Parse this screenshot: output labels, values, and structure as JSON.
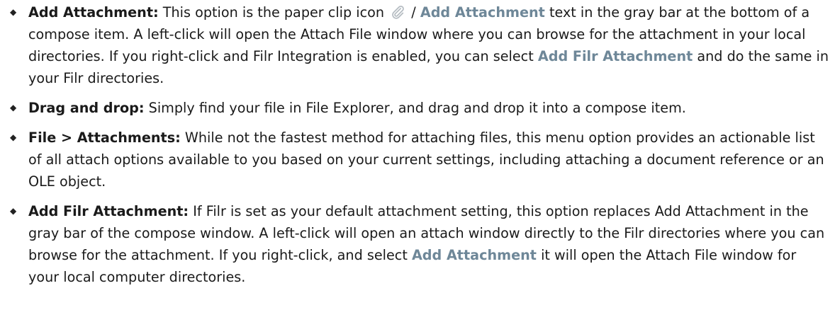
{
  "items": [
    {
      "lead": "Add Attachment:",
      "t1": " This option is the paper clip icon ",
      "sep": " / ",
      "term1": "Add Attachment",
      "t2": " text in the gray bar at the bottom of a compose item. A left-click will open the Attach File window where you can browse for the attachment in your local directories. If you right-click and Filr Integration is enabled, you can select ",
      "term2": "Add Filr Attachment",
      "t3": " and do the same in your Filr directories.",
      "icon": "paperclip-icon"
    },
    {
      "lead": "Drag and drop:",
      "t1": " Simply find your file in File Explorer, and drag and drop it into a compose item."
    },
    {
      "lead": "File > Attachments:",
      "t1": " While not the fastest method for attaching files, this menu option provides an actionable list of all attach options available to you based on your current settings, including attaching a document reference or an OLE object."
    },
    {
      "lead": "Add Filr Attachment:",
      "t1": " If Filr is set as your default attachment setting, this option replaces Add Attachment in the gray bar of the compose window. A left-click will open an attach window directly to the Filr directories where you can browse for the attachment. If you right-click, and select ",
      "term1": "Add Attachment",
      "t2": " it will open the Attach File window for your local computer directories."
    }
  ],
  "bullet_glyph": "◆",
  "colors": {
    "text": "#1a1a1a",
    "ui_term": "#6e8798",
    "icon": "#b5bcc2"
  }
}
